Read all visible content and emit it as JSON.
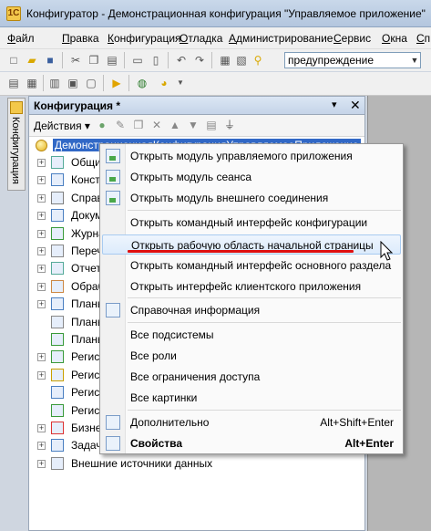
{
  "window": {
    "title": "Конфигуратор - Демонстрационная конфигурация \"Управляемое приложение\"",
    "app_icon_letter": "1С"
  },
  "menu": [
    {
      "label": "Файл",
      "accel": "Ф",
      "rest": "айл"
    },
    {
      "label": "Правка",
      "accel": "П",
      "rest": "равка"
    },
    {
      "label": "Конфигурация",
      "accel": "К",
      "rest": "онфигурация"
    },
    {
      "label": "Отладка",
      "accel": "О",
      "rest": "тладка"
    },
    {
      "label": "Администрирование",
      "accel": "А",
      "rest": "дминистрирование"
    },
    {
      "label": "Сервис",
      "accel": "С",
      "rest": "ервис"
    },
    {
      "label": "Окна",
      "accel": "О",
      "rest": "кна"
    },
    {
      "label": "Сп",
      "accel": "С",
      "rest": "п"
    }
  ],
  "toolbar": {
    "search_value": "предупреждение",
    "icons": [
      "new-icon",
      "open-icon",
      "save-icon",
      "cut-icon",
      "copy-icon",
      "paste-icon",
      "print-icon",
      "preview-icon",
      "undo-icon",
      "redo-icon",
      "find-icon",
      "search-icon"
    ],
    "icons2": [
      "config-icon",
      "db-icon",
      "config-window-icon",
      "run-icon",
      "web-icon",
      "debug-icon"
    ]
  },
  "sidebar_tab": {
    "label": "Конфигурация"
  },
  "panel": {
    "title": "Конфигурация *",
    "actions_label": "Действия",
    "root_label": "ДемонстрационнаяКонфигурацияУправляемоеПриложение",
    "tree": [
      {
        "label": "Общие",
        "expandable": true
      },
      {
        "label": "Констан",
        "expandable": true
      },
      {
        "label": "Справоч",
        "expandable": true
      },
      {
        "label": "Докумен",
        "expandable": true
      },
      {
        "label": "Журналы",
        "expandable": true
      },
      {
        "label": "Перечис",
        "expandable": true
      },
      {
        "label": "Отчеты",
        "expandable": true
      },
      {
        "label": "Обработ",
        "expandable": true
      },
      {
        "label": "Планы",
        "expandable": true
      },
      {
        "label": "Планы",
        "expandable": false
      },
      {
        "label": "Планы",
        "expandable": false
      },
      {
        "label": "Регист",
        "expandable": true
      },
      {
        "label": "Регист",
        "expandable": true
      },
      {
        "label": "Регист",
        "expandable": false
      },
      {
        "label": "Регист",
        "expandable": false
      },
      {
        "label": "Бизне",
        "expandable": true
      },
      {
        "label": "Задачи",
        "expandable": true
      },
      {
        "label": "Внешние источники данных",
        "expandable": true
      }
    ]
  },
  "context_menu": {
    "items": [
      {
        "label": "Открыть модуль управляемого приложения",
        "icon": "module-icon"
      },
      {
        "label": "Открыть модуль сеанса",
        "icon": "module-icon"
      },
      {
        "label": "Открыть модуль внешнего соединения",
        "icon": "module-icon"
      },
      {
        "label": "Открыть командный интерфейс конфигурации"
      },
      {
        "label": "Открыть рабочую область начальной страницы",
        "highlighted": true
      },
      {
        "label": "Открыть командный интерфейс основного раздела"
      },
      {
        "label": "Открыть интерфейс клиентского приложения"
      },
      {
        "label": "Справочная информация",
        "icon": "help-icon"
      },
      {
        "label": "Все подсистемы"
      },
      {
        "label": "Все роли"
      },
      {
        "label": "Все ограничения доступа"
      },
      {
        "label": "Все картинки"
      },
      {
        "label": "Дополнительно",
        "icon": "extra-icon",
        "shortcut": "Alt+Shift+Enter"
      },
      {
        "label": "Свойства",
        "icon": "properties-icon",
        "shortcut": "Alt+Enter",
        "bold": true
      }
    ]
  }
}
